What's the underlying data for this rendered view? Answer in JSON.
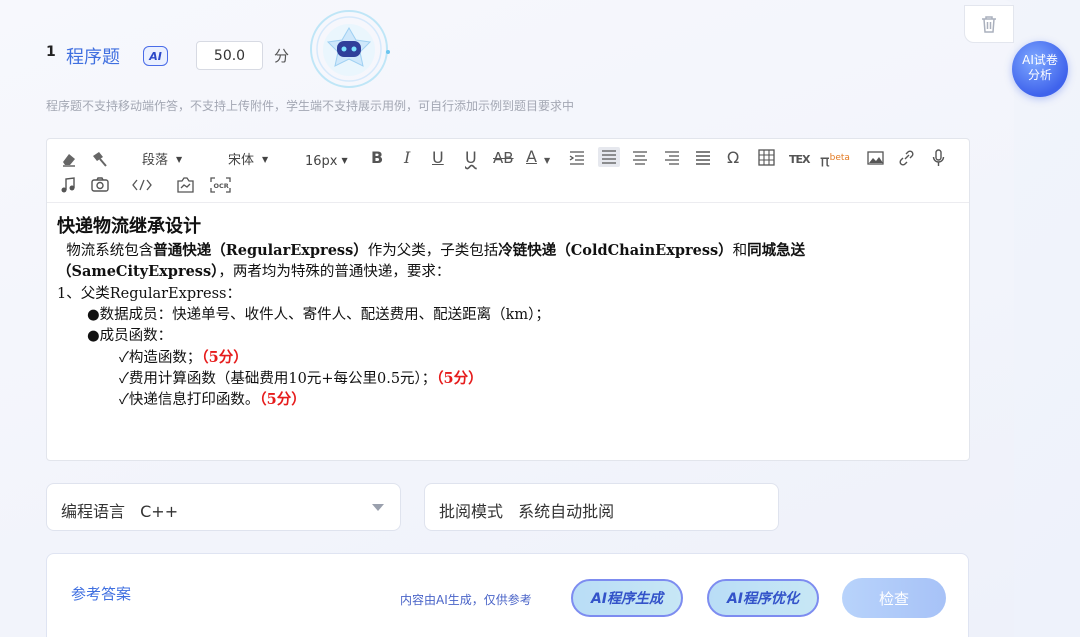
{
  "question": {
    "number": "1",
    "type": "程序题",
    "ai_badge": "AI",
    "score": "50.0",
    "score_unit": "分",
    "hint": "程序题不支持移动端作答，不支持上传附件，学生端不支持展示用例，可自行添加示例到题目要求中"
  },
  "toolbar": {
    "paragraph": "段落",
    "font": "宋体",
    "size": "16px",
    "bold": "B",
    "italic": "I",
    "underline": "U",
    "wave": "U",
    "strike": "AB",
    "color": "A",
    "omega": "Ω",
    "tex": "TEX",
    "pi": "π",
    "pi_sup": "beta"
  },
  "content": {
    "title": "快递物流继承设计",
    "line1_a": "  物流系统包含",
    "line1_b": "普通快递（RegularExpress）",
    "line1_c": "作为父类，子类包括",
    "line1_d": "冷链快递（ColdChainExpress）",
    "line1_e": "和",
    "line1_f": "同城急送",
    "line2_a": "（SameCityExpress）",
    "line2_b": "，两者均为特殊的普通快递，要求：",
    "line3": "1、父类RegularExpress：",
    "line4": "●数据成员：快递单号、收件人、寄件人、配送费用、配送距离（km）；",
    "line5": "●成员函数：",
    "line6_a": "✓构造函数；",
    "line6_b": "（5分）",
    "line7_a": "✓费用计算函数（基础费用10元+每公里0.5元）；",
    "line7_b": "（5分）",
    "line8_a": "✓快递信息打印函数。",
    "line8_b": "（5分）"
  },
  "language": {
    "label": "编程语言",
    "value": "C++"
  },
  "review": {
    "label": "批阅模式",
    "value": "系统自动批阅"
  },
  "answer": {
    "title": "参考答案",
    "note": "内容由AI生成，仅供参考",
    "gen_button": "AI程序生成",
    "opt_button": "AI程序优化",
    "check_button": "检查"
  },
  "float_button": {
    "line1": "AI试卷",
    "line2": "分析"
  }
}
